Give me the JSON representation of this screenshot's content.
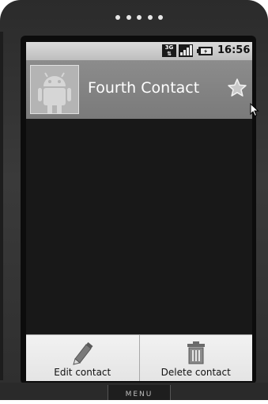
{
  "status_bar": {
    "network": "3G",
    "time": "16:56"
  },
  "contact": {
    "name": "Fourth Contact",
    "starred": false
  },
  "options_menu": {
    "items": [
      {
        "label": "Edit contact",
        "icon": "pencil-icon"
      },
      {
        "label": "Delete contact",
        "icon": "trash-icon"
      }
    ]
  },
  "hardware": {
    "menu_key_label": "MENU"
  },
  "colors": {
    "header_bg": "#808080",
    "screen_bg": "#181818",
    "menu_bg": "#ececec"
  }
}
